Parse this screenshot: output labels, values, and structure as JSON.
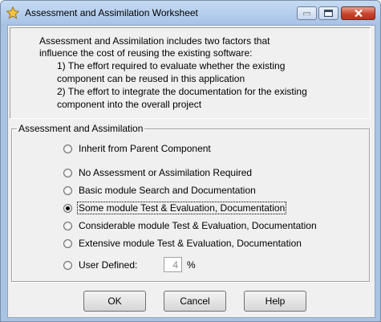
{
  "window": {
    "title": "Assessment and Assimilation Worksheet"
  },
  "info": {
    "lines": [
      "Assessment and Assimilation includes two factors that",
      "influence the cost of reusing the existing software:",
      "1) The effort required to evaluate whether the existing",
      "component can be reused in this application",
      "2) The effort to integrate the documentation for the existing",
      "component into the overall project"
    ]
  },
  "group": {
    "title": "Assessment and Assimilation",
    "options": [
      {
        "label": "Inherit from Parent Component",
        "selected": false
      },
      {
        "label": "No Assessment or Assimilation Required",
        "selected": false
      },
      {
        "label": "Basic module Search and Documentation",
        "selected": false
      },
      {
        "label": "Some module Test & Evaluation, Documentation",
        "selected": true
      },
      {
        "label": "Considerable module Test & Evaluation, Documentation",
        "selected": false
      },
      {
        "label": "Extensive module Test & Evaluation, Documentation",
        "selected": false
      },
      {
        "label": "User Defined:",
        "selected": false
      }
    ],
    "user_defined_value": "4",
    "percent_symbol": "%"
  },
  "buttons": {
    "ok": "OK",
    "cancel": "Cancel",
    "help": "Help"
  },
  "colors": {
    "titlebar": "#b3cdec",
    "frame": "#a9c3e3",
    "close_button": "#c7442c",
    "dialog_background": "#f0f0f0"
  },
  "icons": {
    "app": "star-icon",
    "minimize": "minimize-icon",
    "maximize": "maximize-icon",
    "close": "close-icon"
  }
}
